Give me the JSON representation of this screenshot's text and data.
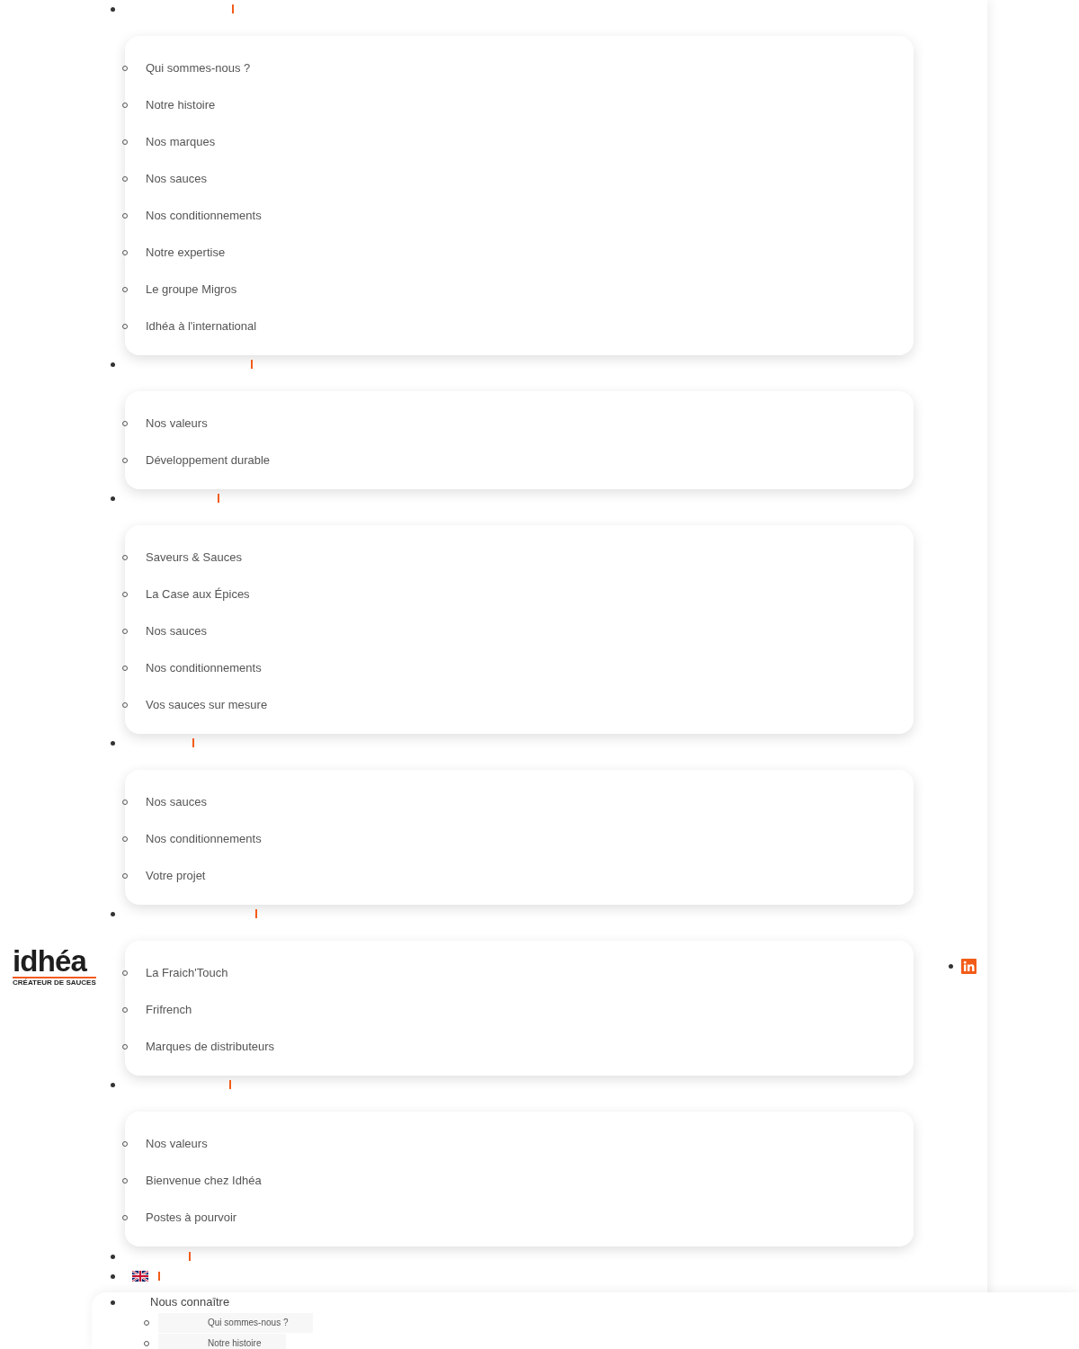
{
  "logo": {
    "name": "idhéa",
    "tagline": "CRÉATEUR DE SAUCES"
  },
  "menu": [
    {
      "kind": "dropdown",
      "children": [
        "Qui sommes-nous ?",
        "Notre histoire",
        "Nos marques",
        "Nos sauces",
        "Nos conditionnements",
        "Notre expertise",
        "Le groupe Migros",
        "Idhéa à l'international"
      ]
    },
    {
      "kind": "dropdown",
      "children": [
        "Nos valeurs",
        "Développement durable"
      ]
    },
    {
      "kind": "dropdown",
      "children": [
        "Saveurs & Sauces",
        "La Case aux Épices",
        "Nos sauces",
        "Nos conditionnements",
        "Vos sauces sur mesure"
      ]
    },
    {
      "kind": "dropdown",
      "children": [
        "Nos sauces",
        "Nos conditionnements",
        "Votre projet"
      ]
    },
    {
      "kind": "dropdown",
      "children": [
        "La Fraich'Touch",
        "Frifrench",
        "Marques de distributeurs"
      ]
    },
    {
      "kind": "dropdown",
      "children": [
        "Nos valeurs",
        "Bienvenue chez Idhéa",
        "Postes à pourvoir"
      ]
    },
    {
      "kind": "link"
    },
    {
      "kind": "language"
    }
  ],
  "mobile_menu": {
    "title": "Nous connaître",
    "items": [
      "Qui sommes-nous ?",
      "Notre histoire"
    ]
  }
}
